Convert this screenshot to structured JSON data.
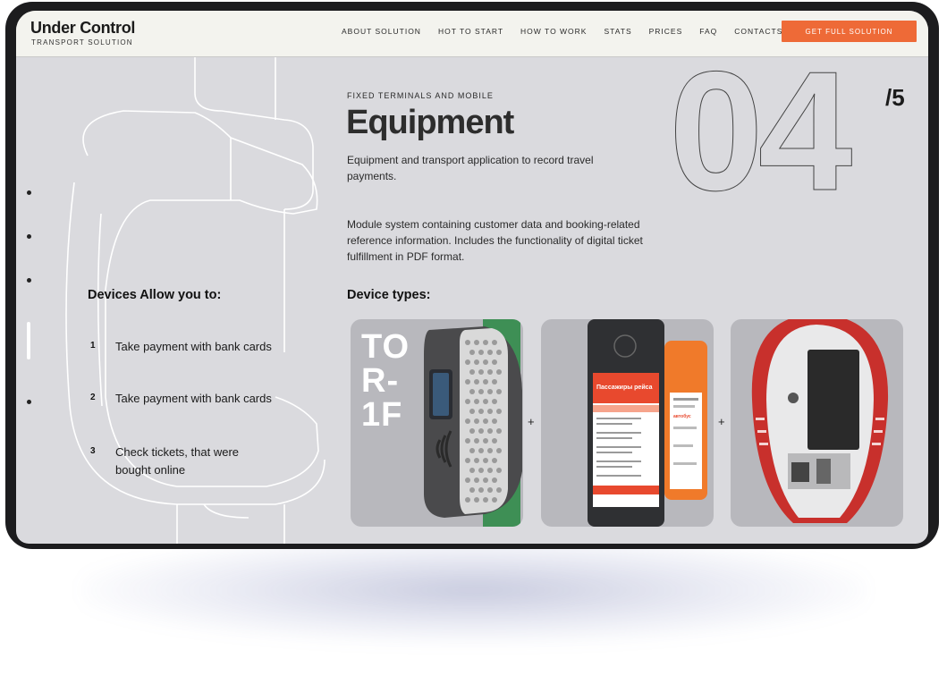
{
  "brand": {
    "title": "Under Control",
    "subtitle": "TRANSPORT SOLUTION"
  },
  "nav": [
    {
      "label": "ABOUT SOLUTION"
    },
    {
      "label": "HOT TO START"
    },
    {
      "label": "HOW TO WORK"
    },
    {
      "label": "STATS"
    },
    {
      "label": "PRICES"
    },
    {
      "label": "FAQ"
    },
    {
      "label": "CONTACTS"
    }
  ],
  "cta": {
    "label": "GET FULL SOLUTION"
  },
  "colors": {
    "accent": "#ee6a37",
    "background": "#dadade",
    "header": "#f3f3ee",
    "card": "#b8b8bd"
  },
  "section": {
    "kicker": "FIXED TERMINALS AND MOBILE",
    "title": "Equipment",
    "intro": "Equipment and transport application to record travel payments.",
    "description": "Module system containing customer data and booking-related reference information. Includes the functionality of digital ticket fulfillment in PDF format.",
    "number": "04",
    "total": "/5"
  },
  "features": {
    "title": "Devices Allow you to:",
    "items": [
      {
        "num": "1",
        "text": "Take payment with bank cards"
      },
      {
        "num": "2",
        "text": "Take payment with bank cards"
      },
      {
        "num": "3",
        "text": "Check tickets, that were bought online"
      }
    ]
  },
  "devices": {
    "title": "Device types:",
    "separator": "+",
    "validator_label": "TOR-1F",
    "validator_lines": [
      "TO",
      "R-",
      "1F"
    ],
    "terminal_screen_title": "Пассажиры рейса",
    "printer_label": "автобус"
  },
  "side_nav": {
    "icons": [
      "dot-icon",
      "dot-icon",
      "dot-icon",
      "active-bar-icon",
      "dot-icon"
    ]
  }
}
